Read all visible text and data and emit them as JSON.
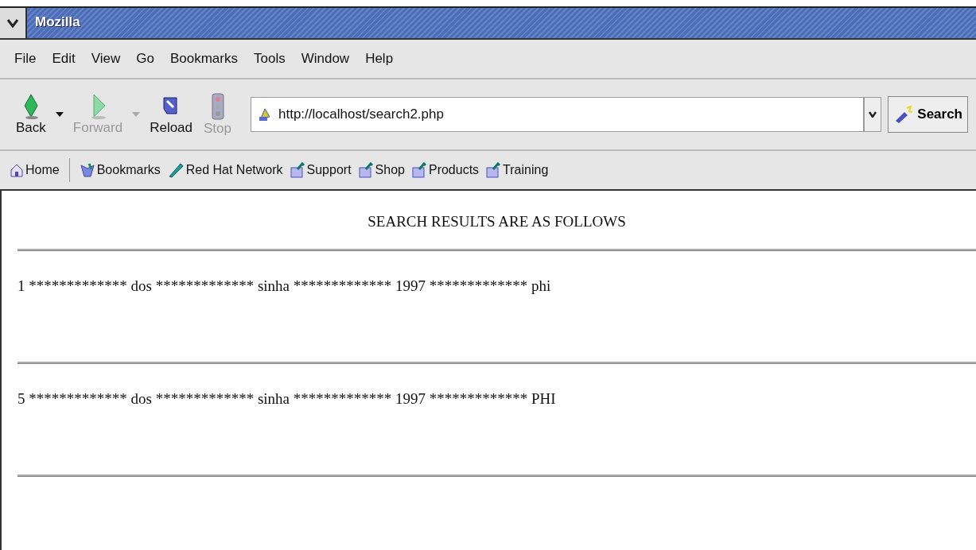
{
  "window": {
    "title": "Mozilla"
  },
  "menu": [
    "File",
    "Edit",
    "View",
    "Go",
    "Bookmarks",
    "Tools",
    "Window",
    "Help"
  ],
  "toolbar": {
    "buttons": [
      {
        "kind": "back",
        "label": "Back",
        "disabled": false,
        "dropdown": true
      },
      {
        "kind": "forward",
        "label": "Forward",
        "disabled": true,
        "dropdown": true
      },
      {
        "kind": "reload",
        "label": "Reload",
        "disabled": false,
        "dropdown": false
      },
      {
        "kind": "stop",
        "label": "Stop",
        "disabled": true,
        "dropdown": false
      }
    ],
    "address": "http://localhost/search2.php",
    "search_button": "Search"
  },
  "personal_toolbar": [
    {
      "kind": "home",
      "label": "Home"
    },
    {
      "kind": "bookmarks",
      "label": "Bookmarks"
    },
    {
      "kind": "pen",
      "label": "Red Hat Network"
    },
    {
      "kind": "folder",
      "label": "Support"
    },
    {
      "kind": "folder",
      "label": "Shop"
    },
    {
      "kind": "folder",
      "label": "Products"
    },
    {
      "kind": "folder",
      "label": "Training"
    }
  ],
  "content": {
    "heading": "SEARCH RESULTS ARE AS FOLLOWS",
    "results": [
      "1 ************* dos ************* sinha ************* 1997 ************* phi",
      "5 ************* dos ************* sinha ************* 1997 ************* PHI"
    ]
  }
}
